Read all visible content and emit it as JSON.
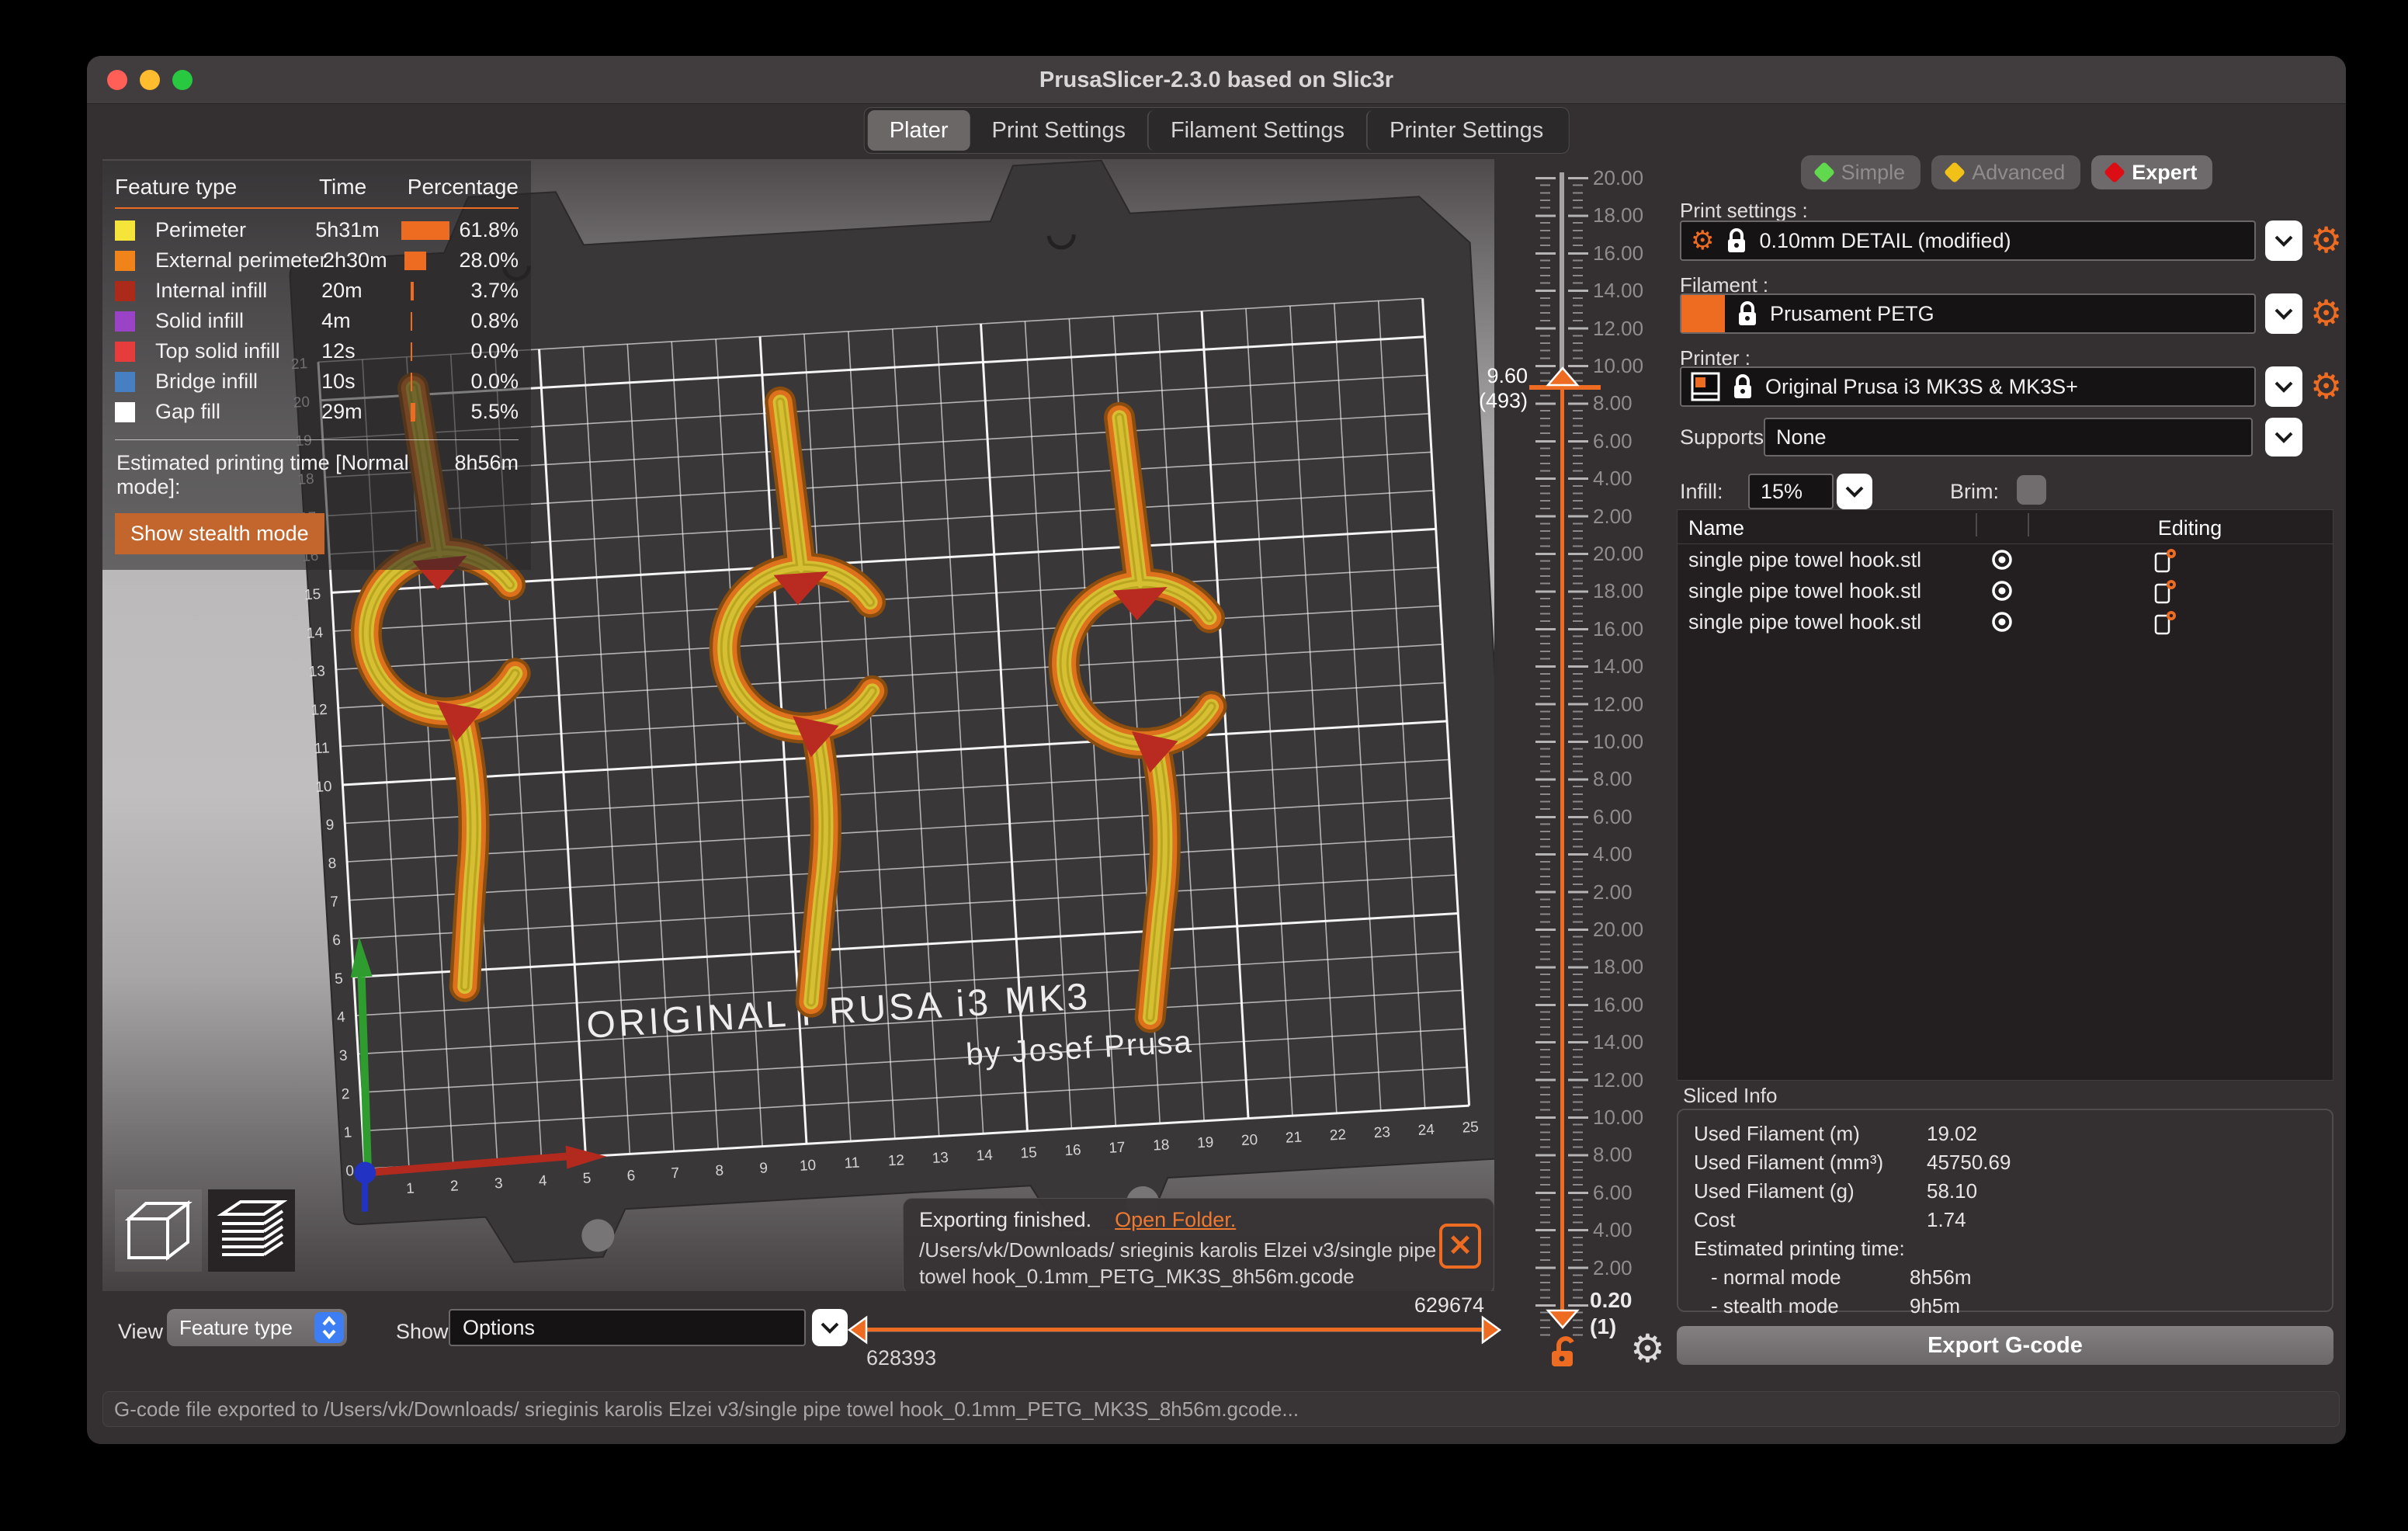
{
  "title_bar": {
    "title": "PrusaSlicer-2.3.0 based on Slic3r"
  },
  "tabs": {
    "items": [
      "Plater",
      "Print Settings",
      "Filament Settings",
      "Printer Settings"
    ],
    "selected": "Plater"
  },
  "legend": {
    "col_feature": "Feature type",
    "col_time": "Time",
    "col_pct": "Percentage",
    "rows": [
      {
        "label": "Perimeter",
        "time": "5h31m",
        "pct": "61.8%",
        "value": 61.8,
        "color": "#f5e43a"
      },
      {
        "label": "External perimeter",
        "time": "2h30m",
        "pct": "28.0%",
        "value": 28.0,
        "color": "#f0841a"
      },
      {
        "label": "Internal infill",
        "time": "20m",
        "pct": "3.7%",
        "value": 3.7,
        "color": "#ab2a1a"
      },
      {
        "label": "Solid infill",
        "time": "4m",
        "pct": "0.8%",
        "value": 0.8,
        "color": "#9b43c6"
      },
      {
        "label": "Top solid infill",
        "time": "12s",
        "pct": "0.0%",
        "value": 0.0,
        "color": "#e63c3c"
      },
      {
        "label": "Bridge infill",
        "time": "10s",
        "pct": "0.0%",
        "value": 0.0,
        "color": "#477fc3"
      },
      {
        "label": "Gap fill",
        "time": "29m",
        "pct": "5.5%",
        "value": 5.5,
        "color": "#ffffff"
      }
    ],
    "estimate_label": "Estimated printing time [Normal mode]:",
    "estimate_value": "8h56m",
    "stealth_button": "Show stealth mode"
  },
  "bed": {
    "title": "ORIGINAL PRUSA i3 MK3",
    "subtitle": "by Josef Prusa",
    "x_max": 25,
    "y_max": 21
  },
  "layer_slider": {
    "labels": [
      "20.00",
      "18.00",
      "16.00",
      "14.00",
      "12.00",
      "10.00",
      "8.00",
      "6.00",
      "4.00",
      "2.00",
      "20.00",
      "18.00",
      "16.00",
      "14.00",
      "12.00",
      "10.00",
      "8.00",
      "6.00",
      "4.00",
      "2.00",
      "20.00",
      "18.00",
      "16.00",
      "14.00",
      "12.00",
      "10.00",
      "8.00",
      "6.00",
      "4.00",
      "2.00"
    ],
    "current_value": "9.60",
    "current_layer": "(493)",
    "bottom_value": "0.20",
    "bottom_layer": "(1)"
  },
  "range_slider": {
    "high": "629674",
    "low": "628393"
  },
  "toast": {
    "message": "Exporting finished.",
    "link": "Open Folder.",
    "path_line1": "/Users/vk/Downloads/ srieginis karolis Elzei v3/single pipe",
    "path_line2": "towel hook_0.1mm_PETG_MK3S_8h56m.gcode"
  },
  "bottom_bar": {
    "view_label": "View",
    "view_value": "Feature type",
    "show_label": "Show",
    "show_value": "Options"
  },
  "right_panel": {
    "modes": [
      {
        "label": "Simple",
        "color": "#62d84e",
        "active": false
      },
      {
        "label": "Advanced",
        "color": "#f2c117",
        "active": false
      },
      {
        "label": "Expert",
        "color": "#dc0d15",
        "active": true
      }
    ],
    "print_settings_label": "Print settings :",
    "print_settings_value": "0.10mm DETAIL (modified)",
    "filament_label": "Filament :",
    "filament_value": "Prusament PETG",
    "printer_label": "Printer :",
    "printer_value": "Original Prusa i3 MK3S & MK3S+",
    "supports_label": "Supports:",
    "supports_value": "None",
    "infill_label": "Infill:",
    "infill_value": "15%",
    "brim_label": "Brim:",
    "table": {
      "name_col": "Name",
      "editing_col": "Editing",
      "rows": [
        "single pipe towel hook.stl",
        "single pipe towel hook.stl",
        "single pipe towel hook.stl"
      ]
    },
    "sliced_info": {
      "title": "Sliced Info",
      "rows": [
        {
          "label": "Used Filament (m)",
          "value": "19.02",
          "indent": false
        },
        {
          "label": "Used Filament (mm³)",
          "value": "45750.69",
          "indent": false
        },
        {
          "label": "Used Filament (g)",
          "value": "58.10",
          "indent": false
        },
        {
          "label": "Cost",
          "value": "1.74",
          "indent": false
        },
        {
          "label": "Estimated printing time:",
          "value": "",
          "indent": false
        },
        {
          "label": "- normal mode",
          "value": "8h56m",
          "indent": true
        },
        {
          "label": "- stealth mode",
          "value": "9h5m",
          "indent": true
        }
      ]
    },
    "export_button": "Export G-code"
  },
  "status_bar": {
    "text": "G-code file exported to /Users/vk/Downloads/ srieginis karolis Elzei v3/single pipe towel hook_0.1mm_PETG_MK3S_8h56m.gcode..."
  }
}
